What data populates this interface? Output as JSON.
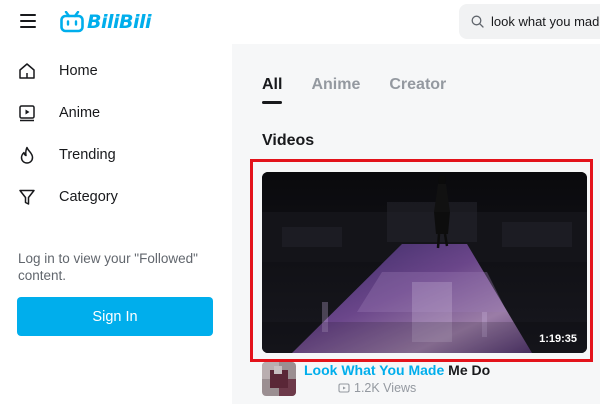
{
  "header": {
    "menu_icon": "hamburger-menu-icon",
    "logo_text": "BiliBili",
    "logo_color": "#00aeec",
    "search": {
      "value": "look what you made",
      "icon": "search-icon"
    }
  },
  "sidebar": {
    "items": [
      {
        "label": "Home",
        "icon": "home-icon"
      },
      {
        "label": "Anime",
        "icon": "anime-play-icon"
      },
      {
        "label": "Trending",
        "icon": "flame-icon"
      },
      {
        "label": "Category",
        "icon": "filter-funnel-icon"
      }
    ],
    "login_prompt": "Log in to view your \"Followed\" content.",
    "sign_in_label": "Sign In",
    "sign_in_color": "#00aeec"
  },
  "main": {
    "tabs": [
      {
        "label": "All",
        "active": true
      },
      {
        "label": "Anime",
        "active": false
      },
      {
        "label": "Creator",
        "active": false
      }
    ],
    "section_title": "Videos",
    "video": {
      "duration": "1:19:35",
      "title_highlight": "Look What You Made",
      "title_rest": " Me Do",
      "views": "1.2K Views",
      "highlight_color": "#e3131b"
    }
  }
}
